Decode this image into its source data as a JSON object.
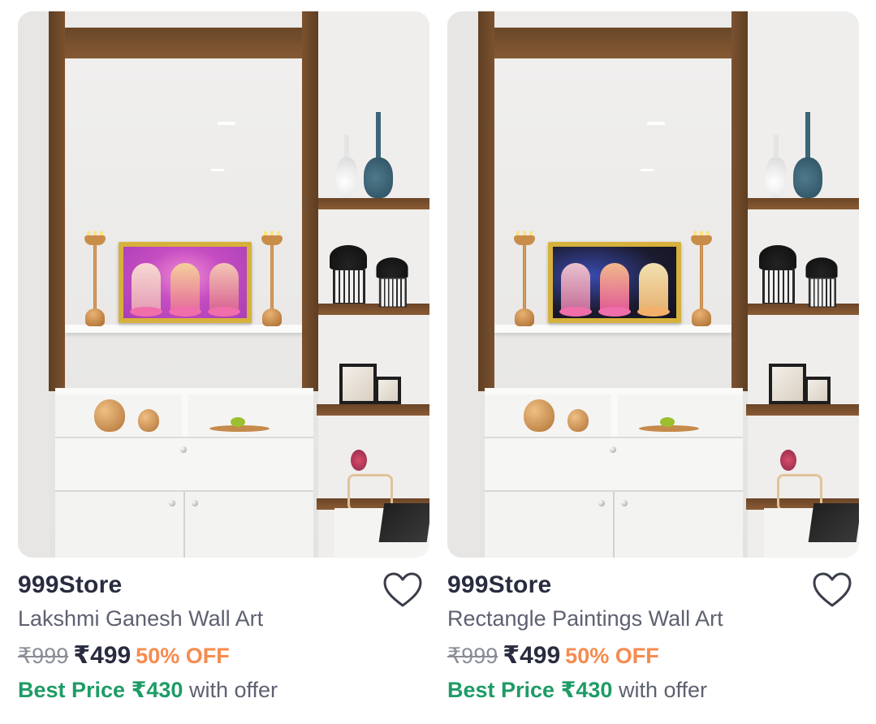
{
  "products": [
    {
      "brand": "999Store",
      "title": "Lakshmi Ganesh Wall Art",
      "mrp": "₹999",
      "price": "₹499",
      "discount": "50% OFF",
      "best_price_label": "Best Price",
      "best_price": "₹430",
      "best_price_suffix": "with offer",
      "wishlist_icon": "heart-outline-icon"
    },
    {
      "brand": "999Store",
      "title": "Rectangle Paintings Wall Art",
      "mrp": "₹999",
      "price": "₹499",
      "discount": "50% OFF",
      "best_price_label": "Best Price",
      "best_price": "₹430",
      "best_price_suffix": "with offer",
      "wishlist_icon": "heart-outline-icon"
    }
  ],
  "colors": {
    "brand_text": "#282c3f",
    "secondary_text": "#5d6170",
    "discount": "#f68b4f",
    "best_price": "#1e9c66",
    "strike": "#8a8d96"
  }
}
